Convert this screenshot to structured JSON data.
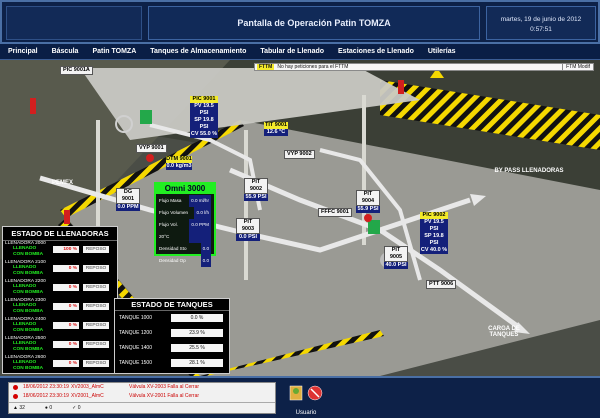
{
  "header": {
    "title": "Pantalla de Operación Patin TOMZA",
    "date": "martes, 19 de junio de 2012",
    "time": "0:57:51"
  },
  "nav": {
    "items": [
      "Principal",
      "Báscula",
      "Patin TOMZA",
      "Tanques de Almacenamiento",
      "Tabular de Llenado",
      "Estaciones de Llenado",
      "Utilerías"
    ]
  },
  "ftm": {
    "label": "FTTM",
    "message": "No hay peticiones para el FTTM",
    "end": "FTM Modif"
  },
  "scene": {
    "labels": {
      "pemex": "PEMEX",
      "bypass": "BY PASS LLENADORAS",
      "carga": "CARGA DE TANQUES"
    },
    "meter": {
      "title": "Omni 3000",
      "rows": [
        {
          "label": "Flujo Masa",
          "value": "0.0 ml/hr"
        },
        {
          "label": "Flujo Volumen",
          "value": "0.0 l/h"
        },
        {
          "label": "Flujo Vol. 20°C",
          "value": "0.0 PPM"
        },
        {
          "label": "Densidad Sto",
          "value": "0.0"
        },
        {
          "label": "Densidad Op",
          "value": "0.0"
        }
      ]
    },
    "tags": [
      {
        "name": "PIC 9001",
        "values": [
          "PV 19.5 PSI",
          "SP 19.8 PSI",
          "CV 55.0 %"
        ]
      },
      {
        "name": "PIC 9002",
        "values": [
          "PV 19.5 PSI",
          "SP 19.8 PSI",
          "CV 40.0 %"
        ]
      },
      {
        "name": "TIT 9001",
        "values": [
          "12.6 °C"
        ]
      },
      {
        "name": "DTM 9001",
        "values": [
          "0.0 kg/m3"
        ]
      },
      {
        "name": "DG 9001",
        "values": [
          "0.0 PPM"
        ]
      },
      {
        "name": "PIT 9002",
        "values": [
          "55.9 PSI"
        ]
      },
      {
        "name": "PIT 9004",
        "values": [
          "55.9 PSI"
        ]
      },
      {
        "name": "PIT 9005",
        "values": [
          "40.0 PSI"
        ]
      },
      {
        "name": "PIT 9003",
        "values": [
          "0.0 PSI"
        ]
      },
      {
        "name": "VYP 9001",
        "values": []
      },
      {
        "name": "VYP 9002",
        "values": []
      },
      {
        "name": "PIC 9001A",
        "values": []
      },
      {
        "name": "PTT 9006",
        "values": []
      },
      {
        "name": "FFFC 9001",
        "values": []
      }
    ]
  },
  "llenadoras": {
    "title": "ESTADO DE LLENADORAS",
    "rows": [
      {
        "name": "LLENADORA 2000",
        "status1": "LLENADO",
        "status2": "CON BOMBA",
        "pct": "100 %",
        "state": "REPOSO"
      },
      {
        "name": "LLENADORA 2100",
        "status1": "LLENADO",
        "status2": "CON BOMBA",
        "pct": "0 %",
        "state": "REPOSO"
      },
      {
        "name": "LLENADORA 2200",
        "status1": "LLENADO",
        "status2": "CON BOMBA",
        "pct": "0 %",
        "state": "REPOSO"
      },
      {
        "name": "LLENADORA 2300",
        "status1": "LLENADO",
        "status2": "CON BOMBA",
        "pct": "0 %",
        "state": "REPOSO"
      },
      {
        "name": "LLENADORA 2400",
        "status1": "LLENADO",
        "status2": "CON BOMBA",
        "pct": "0 %",
        "state": "REPOSO"
      },
      {
        "name": "LLENADORA 2500",
        "status1": "LLENADO",
        "status2": "CON BOMBA",
        "pct": "0 %",
        "state": "REPOSO"
      },
      {
        "name": "LLENADORA 2600",
        "status1": "LLENADO",
        "status2": "CON BOMBA",
        "pct": "0 %",
        "state": "REPOSO"
      }
    ]
  },
  "tanques": {
    "title": "ESTADO DE TANQUES",
    "rows": [
      {
        "name": "TANQUE 1000",
        "value": "0.0 %"
      },
      {
        "name": "TANQUE 1200",
        "value": "23.9 %"
      },
      {
        "name": "TANQUE 1400",
        "value": "25.5 %"
      },
      {
        "name": "TANQUE 1500",
        "value": "28.1 %"
      }
    ]
  },
  "alarms": {
    "rows": [
      {
        "ts": "18/06/2012 23:30:19",
        "id": "XV2003_AlmC",
        "msg": "Válvula XV-2003 Falla al Cerrar"
      },
      {
        "ts": "18/06/2012 23:30:19",
        "id": "XV2001_AlmC",
        "msg": "Válvula XV-2001 Falla al Cerrar"
      }
    ],
    "footer": {
      "count": "32",
      "unack": "0",
      "ack": "0"
    }
  },
  "user": {
    "label": "Usuario"
  },
  "colors": {
    "bg": "#0b1a33",
    "header": "#0d2148",
    "accent": "#4a6fa5",
    "alarm": "#d40000",
    "green": "#22ee22",
    "yellow": "#f2ea2a"
  }
}
